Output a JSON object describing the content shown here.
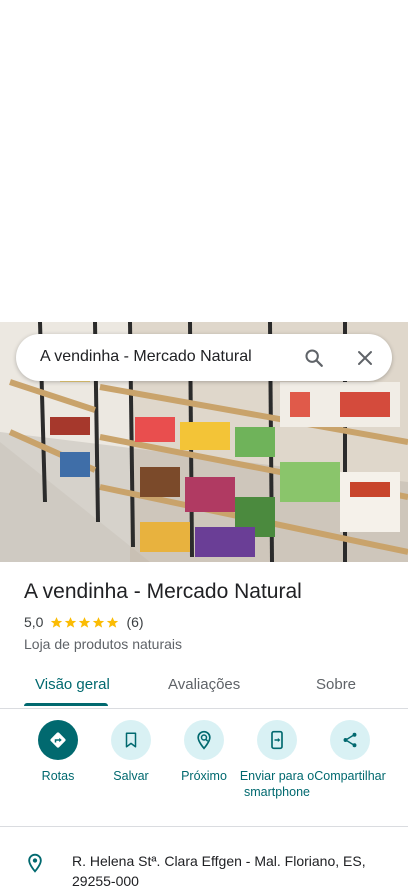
{
  "search": {
    "query": "A vendinha - Mercado Natural"
  },
  "icons": {
    "search": "search-icon",
    "close": "close-icon",
    "star": "star-icon",
    "location": "location-pin-icon"
  },
  "place": {
    "name": "A vendinha - Mercado Natural",
    "rating": "5,0",
    "stars": 5,
    "review_count": "(6)",
    "category": "Loja de produtos naturais",
    "address": "R. Helena Stª. Clara Effgen - Mal. Floriano, ES, 29255-000"
  },
  "tabs": [
    {
      "label": "Visão geral",
      "active": true
    },
    {
      "label": "Avaliações",
      "active": false
    },
    {
      "label": "Sobre",
      "active": false
    }
  ],
  "actions": [
    {
      "label": "Rotas",
      "icon": "directions-icon",
      "primary": true
    },
    {
      "label": "Salvar",
      "icon": "bookmark-icon",
      "primary": false
    },
    {
      "label": "Próximo",
      "icon": "nearby-icon",
      "primary": false
    },
    {
      "label": "Enviar para o smartphone",
      "icon": "send-to-phone-icon",
      "primary": false
    },
    {
      "label": "Compartilhar",
      "icon": "share-icon",
      "primary": false
    }
  ],
  "colors": {
    "accent": "#01696f",
    "accent_light": "#d9f1f4",
    "star": "#fbbc04",
    "text": "#202124",
    "secondary_text": "#5f6368"
  }
}
